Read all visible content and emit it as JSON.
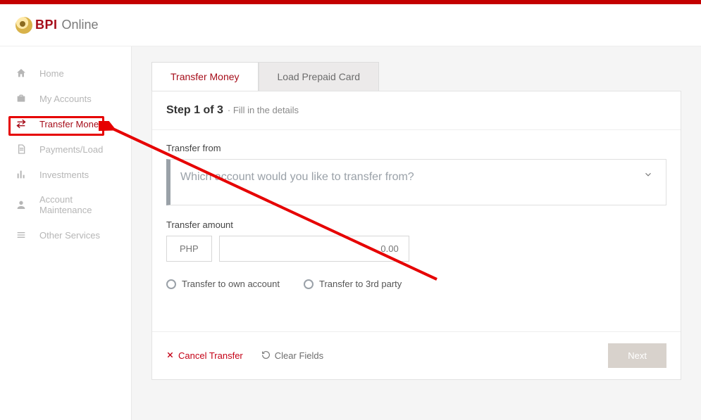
{
  "brand": {
    "bpi": "BPI",
    "online": "Online"
  },
  "sidebar": {
    "items": [
      {
        "label": "Home"
      },
      {
        "label": "My Accounts"
      },
      {
        "label": "Transfer Money"
      },
      {
        "label": "Payments/Load"
      },
      {
        "label": "Investments"
      },
      {
        "label": "Account Maintenance"
      },
      {
        "label": "Other Services"
      }
    ]
  },
  "tabs": {
    "transfer": "Transfer Money",
    "load": "Load Prepaid Card"
  },
  "step": {
    "title": "Step 1 of 3",
    "sub": "· Fill in the details"
  },
  "form": {
    "from_label": "Transfer from",
    "from_placeholder": "Which account would you like to transfer from?",
    "amount_label": "Transfer amount",
    "currency": "PHP",
    "amount_placeholder": "0.00",
    "radio_own": "Transfer to own account",
    "radio_third": "Transfer to 3rd party"
  },
  "footer": {
    "cancel": "Cancel Transfer",
    "clear": "Clear Fields",
    "next": "Next"
  }
}
